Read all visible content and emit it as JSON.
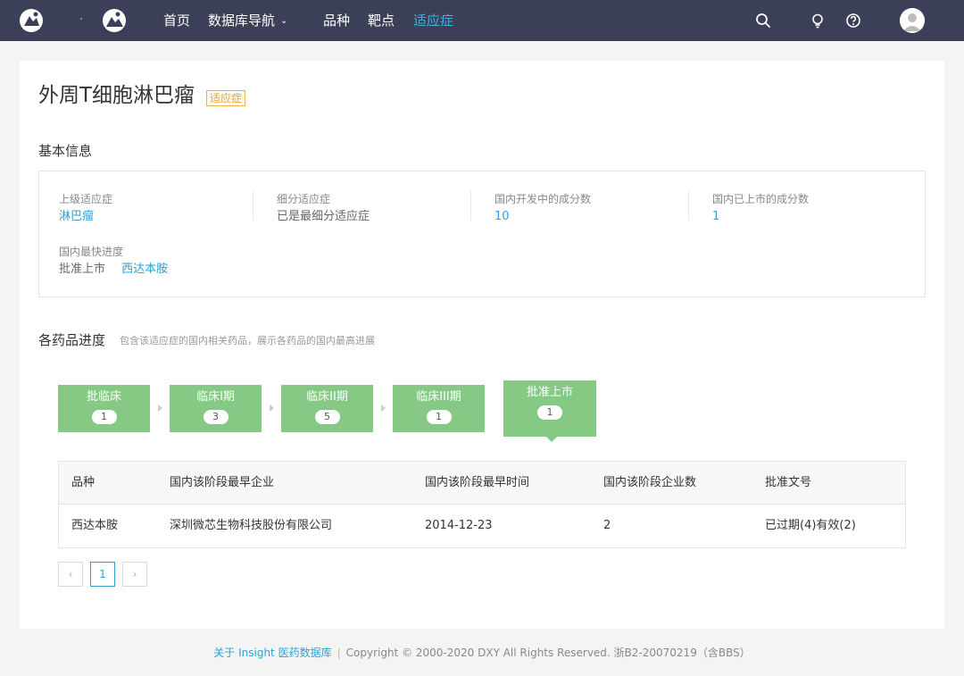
{
  "nav": {
    "items": [
      {
        "label": "首页",
        "dropdown": false,
        "active": false
      },
      {
        "label": "数据库导航",
        "dropdown": true,
        "active": false
      },
      {
        "label": "品种",
        "dropdown": false,
        "active": false
      },
      {
        "label": "靶点",
        "dropdown": false,
        "active": false
      },
      {
        "label": "适应症",
        "dropdown": false,
        "active": true
      }
    ],
    "icons": [
      "search-icon",
      "bulb-icon",
      "help-icon",
      "user-avatar"
    ]
  },
  "page": {
    "title": "外周T细胞淋巴瘤",
    "tag": "适应症"
  },
  "basic_info": {
    "heading": "基本信息",
    "fields": [
      {
        "label": "上级适应症",
        "value": "淋巴瘤",
        "link": true
      },
      {
        "label": "细分适应症",
        "value": "已是最细分适应症",
        "link": false
      },
      {
        "label": "国内开发中的成分数",
        "value": "10",
        "link": true
      },
      {
        "label": "国内已上市的成分数",
        "value": "1",
        "link": true
      }
    ],
    "fastest": {
      "label": "国内最快进度",
      "stage": "批准上市",
      "drug": "西达本胺"
    }
  },
  "progress": {
    "heading": "各药品进度",
    "note": "包含该适应症的国内相关药品，展示各药品的国内最高进展",
    "stages": [
      {
        "name": "批临床",
        "count": "1"
      },
      {
        "name": "临床I期",
        "count": "3"
      },
      {
        "name": "临床II期",
        "count": "5"
      },
      {
        "name": "临床III期",
        "count": "1"
      },
      {
        "name": "批准上市",
        "count": "1"
      }
    ]
  },
  "table": {
    "columns": [
      "品种",
      "国内该阶段最早企业",
      "国内该阶段最早时间",
      "国内该阶段企业数",
      "批准文号"
    ],
    "rows": [
      [
        "西达本胺",
        "深圳微芯生物科技股份有限公司",
        "2014-12-23",
        "2",
        "已过期(4)有效(2)"
      ]
    ]
  },
  "pagination": {
    "prev": "‹",
    "current": "1",
    "next": "›"
  },
  "footer": {
    "link": "关于 Insight 医药数据库",
    "separator": "|",
    "copyright": "Copyright © 2000-2020 DXY All Rights Reserved. 浙B2-20070219（含BBS）"
  },
  "colors": {
    "nav_bg": "#3b3f57",
    "accent": "#2aa3d6",
    "stage_green": "#85c985",
    "tag_orange": "#e8a33a"
  }
}
